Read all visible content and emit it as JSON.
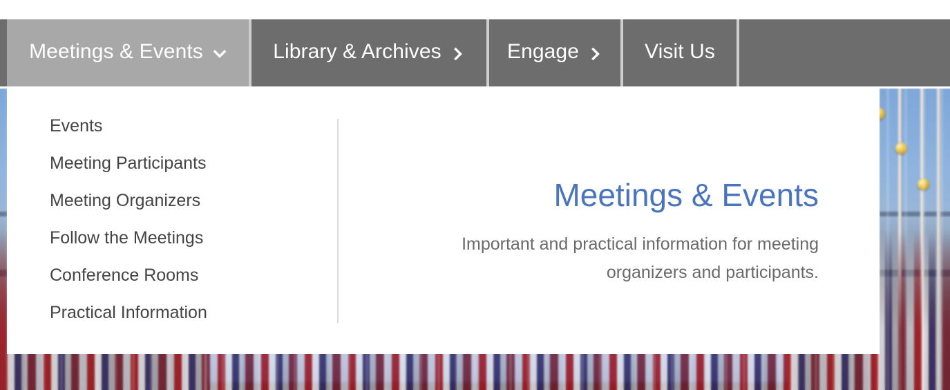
{
  "nav": {
    "items": [
      {
        "label": "Meetings & Events",
        "icon": "chevron-down-icon",
        "active": true,
        "name": "nav-item-meetings-events"
      },
      {
        "label": "Library & Archives",
        "icon": "chevron-right-icon",
        "active": false,
        "name": "nav-item-library-archives"
      },
      {
        "label": "Engage",
        "icon": "chevron-right-icon",
        "active": false,
        "name": "nav-item-engage"
      },
      {
        "label": "Visit Us",
        "icon": "",
        "active": false,
        "name": "nav-item-visit-us"
      }
    ]
  },
  "dropdown": {
    "links": [
      {
        "label": "Events"
      },
      {
        "label": "Meeting Participants"
      },
      {
        "label": "Meeting Organizers"
      },
      {
        "label": "Follow the Meetings"
      },
      {
        "label": "Conference Rooms"
      },
      {
        "label": "Practical Information"
      }
    ],
    "title": "Meetings & Events",
    "description": "Important and practical information for meeting organizers and participants."
  },
  "colors": {
    "nav_background": "#6d6d6d",
    "nav_active": "#a8a8a8",
    "nav_separator": "#cdcfce",
    "panel_background": "#ffffff",
    "title_blue": "#4a75bd",
    "link_text": "#444444",
    "description_text": "#6a6a6a",
    "divider": "#dcdcdc"
  }
}
